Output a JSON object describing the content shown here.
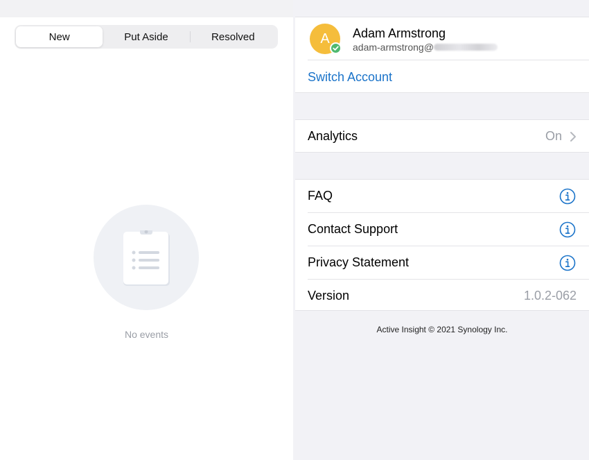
{
  "left": {
    "tabs": [
      {
        "label": "New",
        "active": true
      },
      {
        "label": "Put Aside",
        "active": false
      },
      {
        "label": "Resolved",
        "active": false
      }
    ],
    "empty_state": {
      "icon": "clipboard-icon",
      "text": "No events"
    }
  },
  "right": {
    "account": {
      "avatar_letter": "A",
      "name": "Adam Armstrong",
      "email": "adam-armstrong@",
      "switch_label": "Switch Account"
    },
    "analytics": {
      "label": "Analytics",
      "value": "On"
    },
    "info_rows": [
      {
        "label": "FAQ",
        "icon": "info-icon"
      },
      {
        "label": "Contact Support",
        "icon": "info-icon"
      },
      {
        "label": "Privacy Statement",
        "icon": "info-icon"
      }
    ],
    "version": {
      "label": "Version",
      "value": "1.0.2-062"
    },
    "footer": "Active Insight © 2021 Synology Inc."
  },
  "colors": {
    "accent": "#1a73c9",
    "avatar": "#f5bd3b",
    "check": "#4fb96f",
    "background": "#f2f2f6"
  }
}
